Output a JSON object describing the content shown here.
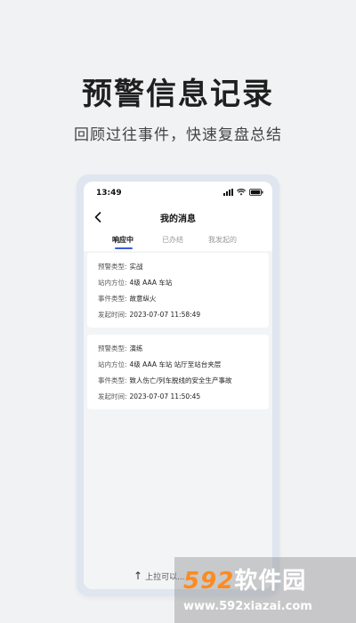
{
  "promo": {
    "headline": "预警信息记录",
    "subhead": "回顾过往事件，快速复盘总结"
  },
  "status_bar": {
    "time": "13:49"
  },
  "nav": {
    "title": "我的消息"
  },
  "tabs": [
    {
      "label": "响应中",
      "active": true
    },
    {
      "label": "已办结",
      "active": false
    },
    {
      "label": "我发起的",
      "active": false
    }
  ],
  "records": [
    {
      "type_label": "预警类型:",
      "type_value": "实战",
      "location_label": "站内方位:",
      "location_value": "4级 AAA 车站",
      "event_label": "事件类型:",
      "event_value": "故意纵火",
      "time_label": "发起时间:",
      "time_value": "2023-07-07 11:58:49"
    },
    {
      "type_label": "预警类型:",
      "type_value": "演练",
      "location_label": "站内方位:",
      "location_value": "4级 AAA 车站 站厅至站台夹层",
      "event_label": "事件类型:",
      "event_value": "致人伤亡/列车脱线的安全生产事故",
      "time_label": "发起时间:",
      "time_value": "2023-07-07 11:50:45"
    }
  ],
  "bottom": {
    "caption": "上拉可以..."
  },
  "watermark": {
    "brand_num": "592",
    "brand_text": "软件园",
    "url": "www.592xiazai.com"
  },
  "colors": {
    "accent": "#3b5bdb",
    "background": "#f1f2f4",
    "frame": "#dfe6f0"
  }
}
